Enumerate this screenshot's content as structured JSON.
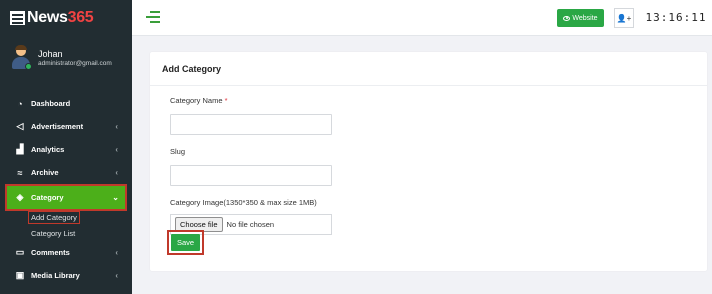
{
  "brand": {
    "prefix": "News",
    "number": "365"
  },
  "user": {
    "name": "Johan",
    "email": "administrator@gmail.com"
  },
  "menu": [
    {
      "label": "Dashboard",
      "icon": "dashboard-icon",
      "chevron": false
    },
    {
      "label": "Advertisement",
      "icon": "megaphone-icon",
      "chevron": true
    },
    {
      "label": "Analytics",
      "icon": "bar-chart-icon",
      "chevron": true
    },
    {
      "label": "Archive",
      "icon": "archive-icon",
      "chevron": true
    },
    {
      "label": "Category",
      "icon": "tag-icon",
      "chevron": true,
      "active": true
    },
    {
      "label": "Comments",
      "icon": "comments-icon",
      "chevron": true
    },
    {
      "label": "Media Library",
      "icon": "media-icon",
      "chevron": true
    }
  ],
  "submenu": [
    "Add Category",
    "Category List"
  ],
  "header": {
    "website_label": "Website",
    "clock": "13:16:11"
  },
  "card": {
    "title": "Add Category",
    "name_label": "Category Name",
    "required_mark": "*",
    "slug_label": "Slug",
    "image_label": "Category Image(1350*350 & max size 1MB)",
    "choose_file": "Choose file",
    "no_file": "No file chosen",
    "save_label": "Save"
  },
  "colors": {
    "sidebar": "#222d32",
    "accent": "#4caf1a",
    "button": "#2aa745",
    "highlight": "#c0392b"
  }
}
